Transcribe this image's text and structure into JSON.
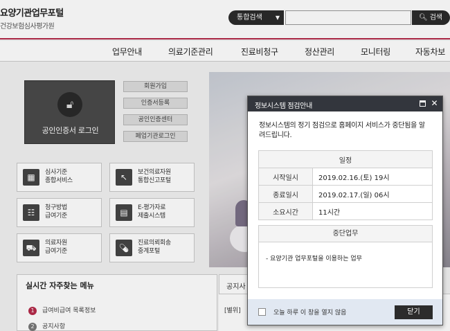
{
  "header": {
    "logo_title": "요양기관업무포털",
    "logo_subtitle": "건강보험심사평가원",
    "search_type": "통합검색",
    "search_type_icon": "chevron-down-icon",
    "search_placeholder": "",
    "search_button": "검색",
    "search_icon": "magnifier-icon",
    "accent": "#b52a4a"
  },
  "nav": {
    "items": [
      "업무안내",
      "의료기준관리",
      "진료비청구",
      "정산관리",
      "모니터링",
      "자동차보"
    ]
  },
  "login": {
    "cert_label": "공인인증서 로그인",
    "buttons": [
      "회원가입",
      "인증서등록",
      "공인인증센터",
      "폐업기관로그인"
    ]
  },
  "services": [
    {
      "line1": "심사기준",
      "line2": "종합서비스"
    },
    {
      "line1": "보건의료자원",
      "line2": "통합신고포털"
    },
    {
      "line1": "청구방법",
      "line2": "급여기준"
    },
    {
      "line1": "E-평가자료",
      "line2": "제출시스템"
    },
    {
      "line1": "의료자원",
      "line2": "급여기준"
    },
    {
      "line1": "진료의뢰회송",
      "line2": "중계포털"
    }
  ],
  "favorites": {
    "title": "실시간 자주찾는 메뉴",
    "items": [
      {
        "num": "1",
        "label": "급여비급여 목록정보",
        "color": "#b52a4a"
      },
      {
        "num": "2",
        "label": "공지사항",
        "color": "#777777"
      }
    ]
  },
  "notice": {
    "tab": "공지사",
    "line": "[별위]"
  },
  "modal": {
    "title": "정보시스템 점검안내",
    "message": "정보시스템의 정기 점검으로 홈페이지 서비스가 중단됨을 알려드립니다.",
    "schedule_caption": "일정",
    "rows": [
      {
        "key": "시작일시",
        "value": "2019.02.16.(토) 19시"
      },
      {
        "key": "종료일시",
        "value": "2019.02.17.(일) 06시"
      },
      {
        "key": "소요시간",
        "value": "11시간"
      }
    ],
    "suspend_caption": "중단업무",
    "suspend_item": "- 요양기관 업무포털을 이용하는 업무",
    "checkbox_label": "오늘 하루 이 창을 열지 않음",
    "close_button": "닫기"
  }
}
